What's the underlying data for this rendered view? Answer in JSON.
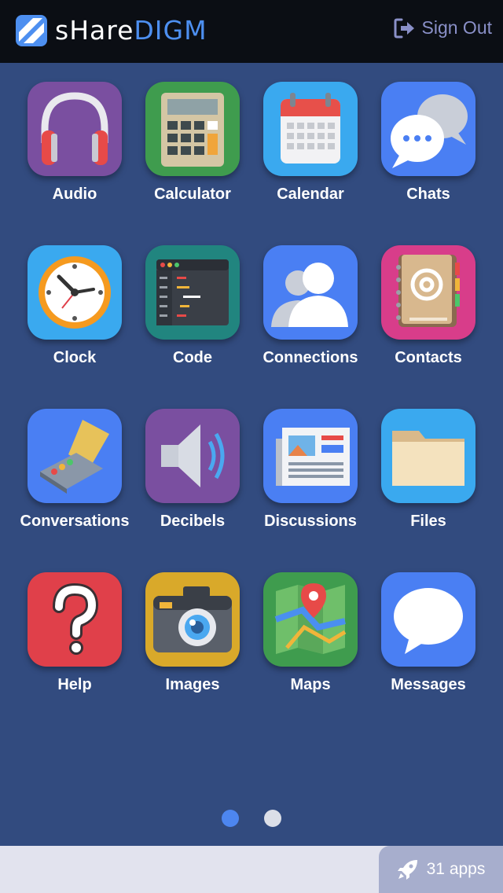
{
  "brand": {
    "part1": "sHare",
    "part2": "DIGM"
  },
  "header": {
    "signout_label": "Sign Out"
  },
  "apps": [
    {
      "label": "Audio",
      "icon": "headphones-icon",
      "bg": "#7a4fa0"
    },
    {
      "label": "Calculator",
      "icon": "calculator-icon",
      "bg": "#3f9c4e"
    },
    {
      "label": "Calendar",
      "icon": "calendar-icon",
      "bg": "#3aa9ef"
    },
    {
      "label": "Chats",
      "icon": "chat-bubbles-icon",
      "bg": "#4a7ff3"
    },
    {
      "label": "Clock",
      "icon": "clock-icon",
      "bg": "#3aa9ef"
    },
    {
      "label": "Code",
      "icon": "code-editor-icon",
      "bg": "#21857f"
    },
    {
      "label": "Connections",
      "icon": "people-icon",
      "bg": "#4a7ff3"
    },
    {
      "label": "Contacts",
      "icon": "address-book-icon",
      "bg": "#d83d8a"
    },
    {
      "label": "Conversations",
      "icon": "voice-recorder-icon",
      "bg": "#4a7ff3"
    },
    {
      "label": "Decibels",
      "icon": "speaker-icon",
      "bg": "#7a4fa0"
    },
    {
      "label": "Discussions",
      "icon": "newspaper-icon",
      "bg": "#4a7ff3"
    },
    {
      "label": "Files",
      "icon": "folder-icon",
      "bg": "#3aa9ef"
    },
    {
      "label": "Help",
      "icon": "question-mark-icon",
      "bg": "#e0404a"
    },
    {
      "label": "Images",
      "icon": "camera-icon",
      "bg": "#d9a92a"
    },
    {
      "label": "Maps",
      "icon": "map-icon",
      "bg": "#3f9c4e"
    },
    {
      "label": "Messages",
      "icon": "message-bubble-icon",
      "bg": "#4a7ff3"
    }
  ],
  "pagination": {
    "pages": 2,
    "current": 1
  },
  "footer": {
    "apps_count_label": "31 apps",
    "icon": "rocket-icon"
  }
}
